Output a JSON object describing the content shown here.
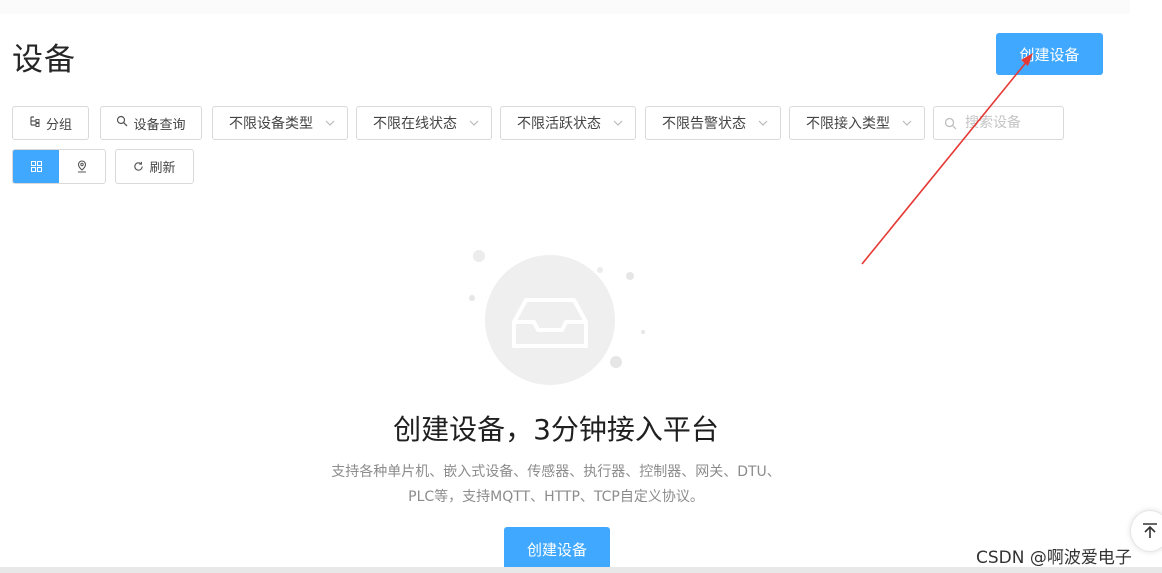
{
  "page": {
    "title": "设备"
  },
  "header": {
    "create_button": "创建设备"
  },
  "toolbar": {
    "group_button": "分组",
    "query_button": "设备查询",
    "filters": [
      "不限设备类型",
      "不限在线状态",
      "不限活跃状态",
      "不限告警状态",
      "不限接入类型"
    ],
    "search_placeholder": "搜索设备",
    "refresh_button": "刷新"
  },
  "view_toggle": {
    "active": "grid",
    "options": [
      "grid-icon",
      "map-pin-icon"
    ]
  },
  "empty_state": {
    "title": "创建设备，3分钟接入平台",
    "desc_line1": "支持各种单片机、嵌入式设备、传感器、执行器、控制器、网关、DTU、",
    "desc_line2": "PLC等，支持MQTT、HTTP、TCP自定义协议。",
    "create_button": "创建设备"
  },
  "watermark": "CSDN @啊波爱电子",
  "colors": {
    "primary": "#40a9ff",
    "annotation_arrow": "#e53935",
    "text_dark": "#1f1f1f"
  }
}
